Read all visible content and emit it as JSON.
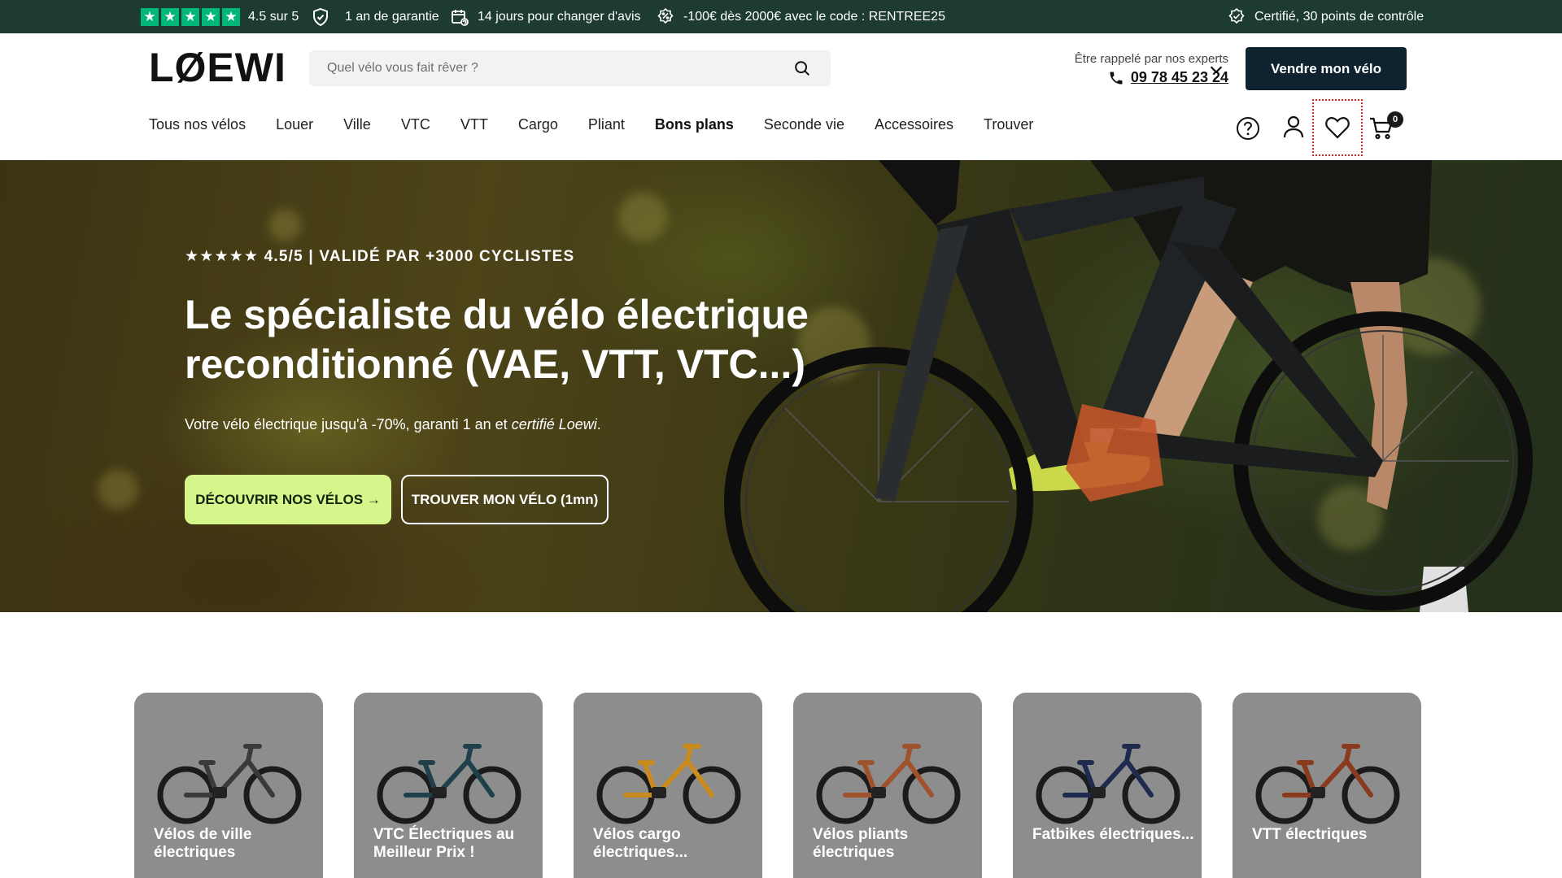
{
  "topbar": {
    "rating": "4.5 sur 5",
    "warranty": "1 an de garantie",
    "returns": "14 jours pour changer d'avis",
    "promo": "-100€ dès 2000€ avec le code : RENTREE25",
    "certified": "Certifié, 30 points de contrôle"
  },
  "header": {
    "logo": "LØEWI",
    "search_placeholder": "Quel vélo vous fait rêver ?",
    "callback_text": "Être rappelé par nos experts",
    "phone": "09 78 45 23 24",
    "sell_button": "Vendre mon vélo",
    "cart_count": "0"
  },
  "nav": {
    "items": [
      "Tous nos vélos",
      "Louer",
      "Ville",
      "VTC",
      "VTT",
      "Cargo",
      "Pliant",
      "Bons plans",
      "Seconde vie",
      "Accessoires",
      "Trouver"
    ]
  },
  "hero": {
    "rating": "★★★★★ 4.5/5  |  VALIDÉ PAR +3000 CYCLISTES",
    "title": "Le spécialiste du vélo électrique reconditionné (VAE, VTT, VTC...)",
    "subtitle_plain": "Votre vélo électrique jusqu'à -70%, garanti 1 an et ",
    "subtitle_italic": "certifié Loewi",
    "subtitle_end": ".",
    "cta_primary": "DÉCOUVRIR NOS VÉLOS →",
    "cta_secondary": "TROUVER MON VÉLO (1mn)"
  },
  "categories": [
    {
      "label": "Vélos de ville électriques",
      "frame_color": "#3a3a3a"
    },
    {
      "label": "VTC Électriques au Meilleur Prix !",
      "frame_color": "#1f3f4a"
    },
    {
      "label": "Vélos cargo électriques...",
      "frame_color": "#c98a1e"
    },
    {
      "label": "Vélos pliants électriques",
      "frame_color": "#a0522d"
    },
    {
      "label": "Fatbikes électriques...",
      "frame_color": "#1e2b4f"
    },
    {
      "label": "VTT électriques",
      "frame_color": "#8a3a1e"
    }
  ],
  "colors": {
    "topbar_bg": "#1d3b33",
    "trustpilot_green": "#00b67a",
    "sell_button_bg": "#0f2230",
    "cta_green": "#d6f58a",
    "category_bg": "#8d8d8d"
  }
}
